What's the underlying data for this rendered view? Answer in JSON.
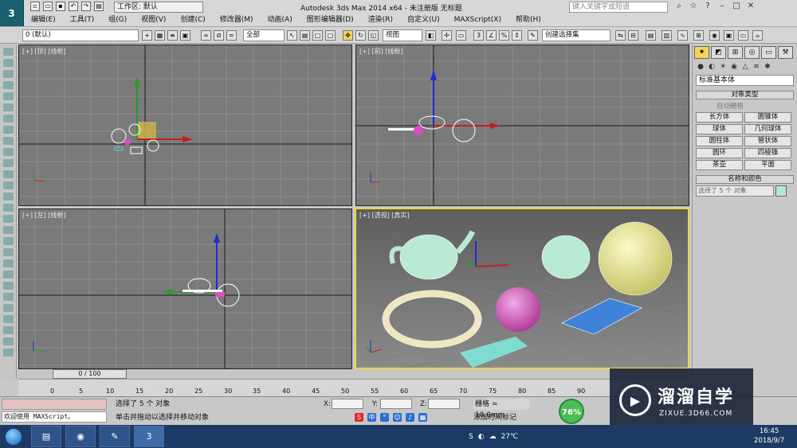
{
  "window": {
    "title": "Autodesk 3ds Max  2014 x64   - 未注册版   无标题",
    "workspace": "工作区: 默认",
    "search_placeholder": "键入关键字或短语"
  },
  "menu": [
    "编辑(E)",
    "工具(T)",
    "组(G)",
    "视图(V)",
    "创建(C)",
    "修改器(M)",
    "动画(A)",
    "图形编辑器(D)",
    "渲染(R)",
    "自定义(U)",
    "MAXScript(X)",
    "帮助(H)"
  ],
  "toolbar": {
    "layer_select": "0 (默认)",
    "filter_select": "全部",
    "coord_select": "视图",
    "named_selection": "创建选择集"
  },
  "viewports": {
    "top": "[+] [顶] [线框]",
    "front": "[+] [前] [线框]",
    "left": "[+] [左] [线框]",
    "perspective": "[+] [透视] [真实]"
  },
  "command_panel": {
    "category": "标准基本体",
    "object_type_header": "对象类型",
    "autogrid": "自动栅格",
    "objects": [
      "长方体",
      "圆锥体",
      "球体",
      "几何球体",
      "圆柱体",
      "管状体",
      "圆环",
      "四棱锥",
      "茶壶",
      "平面"
    ],
    "name_color_header": "名称和颜色",
    "name_value": "选择了 5 个 对象",
    "object_color": "#b5e8d0"
  },
  "timeline": {
    "frame_display": "0 / 100",
    "ticks": [
      "0",
      "5",
      "10",
      "15",
      "20",
      "25",
      "30",
      "35",
      "40",
      "45",
      "50",
      "55",
      "60",
      "65",
      "70",
      "75",
      "80",
      "85",
      "90"
    ]
  },
  "status": {
    "maxscript_listener": "欢迎使用 MAXScript。",
    "selection": "选择了 5 个 对象",
    "prompt": "单击并拖动以选择并移动对象",
    "x_label": "X:",
    "y_label": "Y:",
    "z_label": "Z:",
    "grid": "栅格 = 10.0mm",
    "add_time_tag": "添加时间标记",
    "gauge_value": "76%"
  },
  "watermark": {
    "title": "溜溜自学",
    "url": "ZIXUE.3D66.COM"
  },
  "taskbar": {
    "temperature": "27℃",
    "time": "16:45",
    "date": "2018/9/7"
  }
}
